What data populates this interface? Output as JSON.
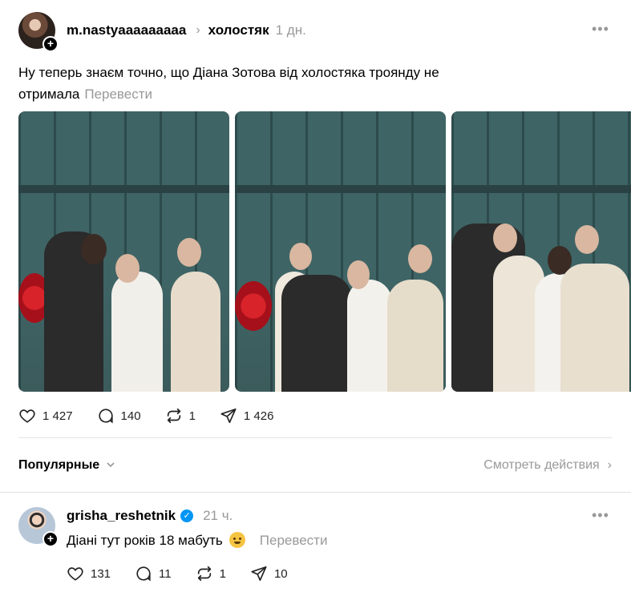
{
  "post": {
    "username": "m.nastyaaaaaaaaa",
    "topic": "холостяк",
    "time": "1 дн.",
    "more": "•••",
    "text_line1": "Ну теперь знаєм точно, що Діана Зотова від холостяка троянду не",
    "text_line2": "отримала",
    "translate": "Перевести",
    "stats": {
      "likes": "1 427",
      "comments": "140",
      "reposts": "1",
      "shares": "1 426"
    }
  },
  "sort": {
    "label": "Популярные",
    "see_actions": "Смотреть действия"
  },
  "reply": {
    "username": "grisha_reshetnik",
    "verified": "✓",
    "time": "21 ч.",
    "more": "•••",
    "text": "Діані тут років 18 мабуть",
    "translate": "Перевести",
    "stats": {
      "likes": "131",
      "comments": "11",
      "reposts": "1",
      "shares": "10"
    }
  },
  "icons": {
    "plus": "+",
    "chevron_right": "›",
    "chevron_down": "⌄"
  },
  "colors": {
    "muted": "#999999",
    "verified": "#0095f6",
    "divider": "#e3e3e3"
  }
}
